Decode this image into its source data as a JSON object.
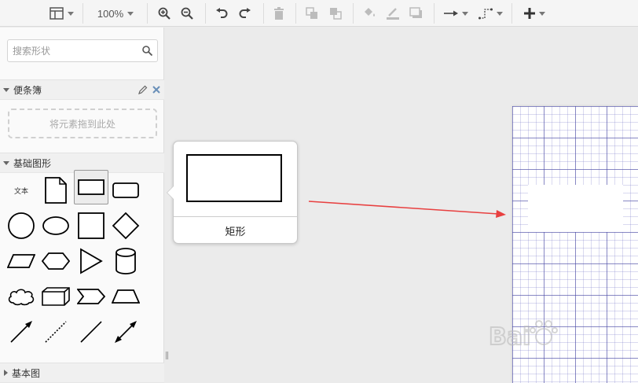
{
  "toolbar": {
    "zoom": "100%",
    "icons": [
      "format-panel-icon",
      "zoom-in-icon",
      "zoom-out-icon",
      "undo-icon",
      "redo-icon",
      "delete-icon",
      "to-front-icon",
      "to-back-icon",
      "fill-color-icon",
      "line-color-icon",
      "shadow-icon",
      "connection-arrow-icon",
      "waypoints-icon",
      "insert-plus-icon"
    ]
  },
  "sidebar": {
    "search": {
      "placeholder": "搜索形状",
      "value": ""
    },
    "scratchpad": {
      "title": "便条簿",
      "dropzone": "将元素拖到此处"
    },
    "general": {
      "title": "基础图形",
      "text_shape": "文本"
    },
    "advanced": {
      "title": "基本图"
    }
  },
  "tooltip": {
    "name": "矩形"
  },
  "colors": {
    "arrow": "#e84040",
    "grid": "#4646a0",
    "toolbar_bg": "#f5f5f5",
    "canvas_bg": "#ebebeb"
  }
}
